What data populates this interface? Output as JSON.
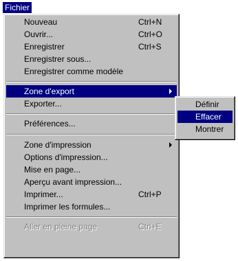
{
  "menubar": {
    "active_menu": "Fichier"
  },
  "menu": {
    "items": [
      {
        "label": "Nouveau",
        "shortcut": "Ctrl+N"
      },
      {
        "label": "Ouvrir...",
        "shortcut": "Ctrl+O"
      },
      {
        "label": "Enregistrer",
        "shortcut": "Ctrl+S"
      },
      {
        "label": "Enregistrer sous...",
        "shortcut": ""
      },
      {
        "label": "Enregistrer comme modèle",
        "shortcut": ""
      },
      {
        "label": "Zone d'export",
        "shortcut": "",
        "submenu": "arrow-right-icon"
      },
      {
        "label": "Exporter...",
        "shortcut": ""
      },
      {
        "label": "Préférences...",
        "shortcut": ""
      },
      {
        "label": "Zone d'impression",
        "shortcut": "",
        "submenu": "arrow-right-icon"
      },
      {
        "label": "Options d'impression...",
        "shortcut": ""
      },
      {
        "label": "Mise en page...",
        "shortcut": ""
      },
      {
        "label": "Aperçu avant impression...",
        "shortcut": ""
      },
      {
        "label": "Imprimer...",
        "shortcut": "Ctrl+P"
      },
      {
        "label": "Imprimer les formules...",
        "shortcut": ""
      },
      {
        "label": "Aller en pleine page",
        "shortcut": "Ctrl+E",
        "disabled": true
      }
    ]
  },
  "submenu": {
    "items": [
      {
        "label": "Définir"
      },
      {
        "label": "Effacer"
      },
      {
        "label": "Montrer"
      }
    ]
  },
  "colors": {
    "menu_background": "#c0c0c0",
    "highlight": "#000080",
    "highlight_text": "#ffffff",
    "disabled_text": "#808080"
  }
}
